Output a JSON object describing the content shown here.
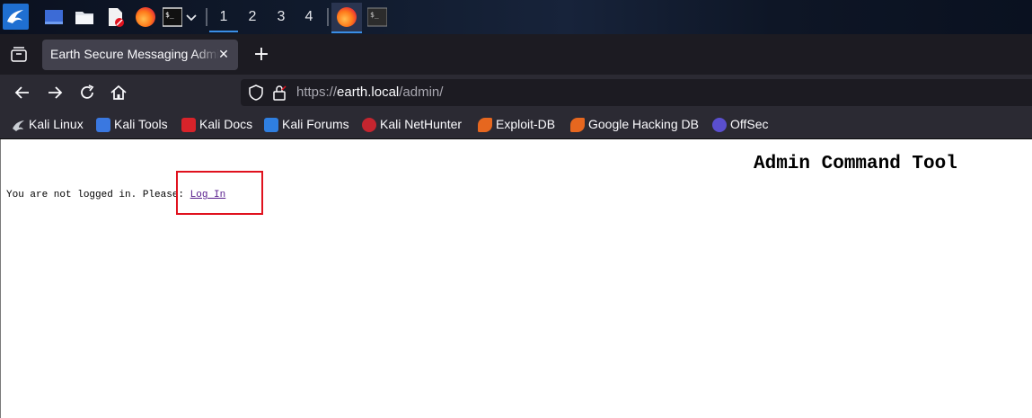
{
  "taskbar": {
    "workspaces": [
      "1",
      "2",
      "3",
      "4"
    ],
    "active_workspace": "1",
    "icons": [
      "kali-menu-icon",
      "show-desktop-icon",
      "file-manager-icon",
      "text-editor-icon",
      "firefox-icon",
      "terminal-icon",
      "chevron-down-icon"
    ]
  },
  "browser": {
    "tab_title": "Earth Secure Messaging Admin",
    "tab_close": "✕",
    "new_tab": "+",
    "url_scheme": "https://",
    "url_host": "earth.local",
    "url_path": "/admin/",
    "bookmarks": [
      {
        "label": "Kali Linux",
        "icon": "kali-dragon-icon",
        "color": "#9aa0a6"
      },
      {
        "label": "Kali Tools",
        "icon": "kali-tools-icon",
        "color": "#3a78e0"
      },
      {
        "label": "Kali Docs",
        "icon": "kali-docs-icon",
        "color": "#d8232a"
      },
      {
        "label": "Kali Forums",
        "icon": "kali-forums-icon",
        "color": "#2f7fe0"
      },
      {
        "label": "Kali NetHunter",
        "icon": "nethunter-icon",
        "color": "#c4252f"
      },
      {
        "label": "Exploit-DB",
        "icon": "exploit-db-icon",
        "color": "#e6671f"
      },
      {
        "label": "Google Hacking DB",
        "icon": "ghdb-icon",
        "color": "#e6671f"
      },
      {
        "label": "OffSec",
        "icon": "offsec-icon",
        "color": "#5a4fcf"
      }
    ]
  },
  "page": {
    "heading": "Admin Command Tool",
    "message_prefix": "You are not logged in. Please: ",
    "login_link": "Log In"
  },
  "colors": {
    "accent": "#3a8ee6",
    "highlight_box": "#e0121e",
    "link_visited": "#551a8b"
  }
}
